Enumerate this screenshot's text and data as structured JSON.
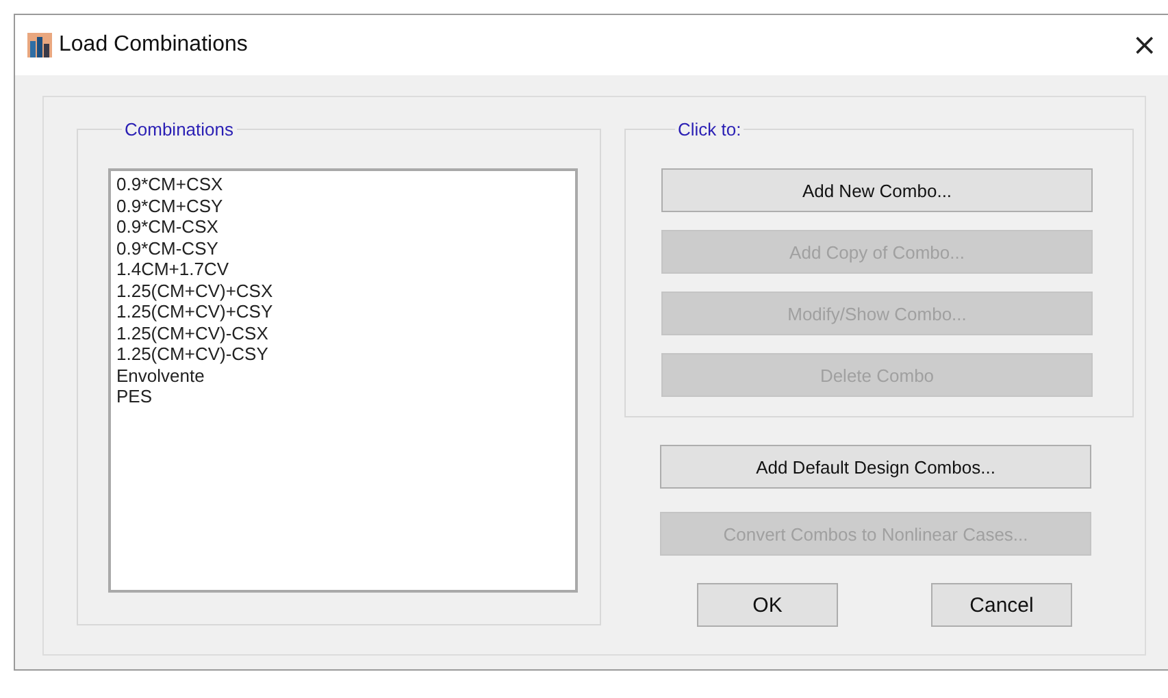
{
  "window": {
    "title": "Load Combinations",
    "close": "×"
  },
  "combinations": {
    "legend": "Combinations",
    "items": [
      {
        "label": "0.9*CM+CSX"
      },
      {
        "label": "0.9*CM+CSY"
      },
      {
        "label": "0.9*CM-CSX"
      },
      {
        "label": "0.9*CM-CSY"
      },
      {
        "label": "1.4CM+1.7CV"
      },
      {
        "label": "1.25(CM+CV)+CSX"
      },
      {
        "label": "1.25(CM+CV)+CSY"
      },
      {
        "label": "1.25(CM+CV)-CSX"
      },
      {
        "label": "1.25(CM+CV)-CSY"
      },
      {
        "label": "Envolvente"
      },
      {
        "label": "PES"
      }
    ]
  },
  "click_to": {
    "legend": "Click to:",
    "buttons": [
      {
        "label": "Add New Combo...",
        "disabled": false
      },
      {
        "label": "Add Copy of Combo...",
        "disabled": true
      },
      {
        "label": "Modify/Show Combo...",
        "disabled": true
      },
      {
        "label": "Delete Combo",
        "disabled": true
      }
    ]
  },
  "extra_buttons": [
    {
      "label": "Add Default Design Combos...",
      "disabled": false
    },
    {
      "label": "Convert Combos to Nonlinear Cases...",
      "disabled": true
    }
  ],
  "dialog_buttons": [
    {
      "label": "OK"
    },
    {
      "label": "Cancel"
    }
  ]
}
